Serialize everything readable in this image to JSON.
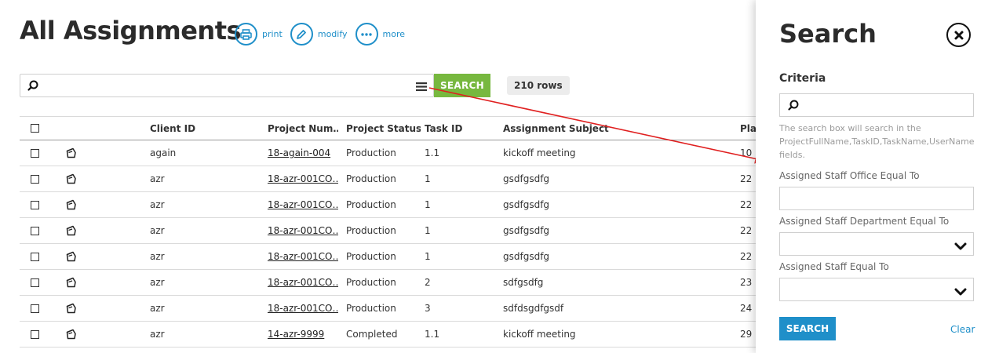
{
  "page": {
    "title": "All Assignments",
    "actions": [
      {
        "label": "print",
        "icon": "printer-icon"
      },
      {
        "label": "modify",
        "icon": "pencil-icon"
      },
      {
        "label": "more",
        "icon": "more-dots-icon"
      }
    ]
  },
  "search": {
    "value": "",
    "button_label": "SEARCH",
    "rows_count": "210 rows"
  },
  "table": {
    "columns": [
      "",
      "",
      "Client ID",
      "Project Num…",
      "Project Status",
      "Task ID",
      "Assignment Subject",
      "Plar"
    ],
    "rows": [
      {
        "client": "again",
        "project": "18-again-004",
        "status": "Production",
        "task": "1.1",
        "subject": "kickoff meeting",
        "plan": "10"
      },
      {
        "client": "azr",
        "project": "18-azr-001CO…",
        "status": "Production",
        "task": "1",
        "subject": "gsdfgsdfg",
        "plan": "22"
      },
      {
        "client": "azr",
        "project": "18-azr-001CO…",
        "status": "Production",
        "task": "1",
        "subject": "gsdfgsdfg",
        "plan": "22"
      },
      {
        "client": "azr",
        "project": "18-azr-001CO…",
        "status": "Production",
        "task": "1",
        "subject": "gsdfgsdfg",
        "plan": "22"
      },
      {
        "client": "azr",
        "project": "18-azr-001CO…",
        "status": "Production",
        "task": "1",
        "subject": "gsdfgsdfg",
        "plan": "22"
      },
      {
        "client": "azr",
        "project": "18-azr-001CO…",
        "status": "Production",
        "task": "2",
        "subject": "sdfgsdfg",
        "plan": "23"
      },
      {
        "client": "azr",
        "project": "18-azr-001CO…",
        "status": "Production",
        "task": "3",
        "subject": "sdfdsgdfgsdf",
        "plan": "24"
      },
      {
        "client": "azr",
        "project": "14-azr-9999",
        "status": "Completed",
        "task": "1.1",
        "subject": "kickoff meeting",
        "plan": "29"
      }
    ]
  },
  "panel": {
    "title": "Search",
    "criteria_label": "Criteria",
    "search_value": "",
    "help_text": "The search box will search in the ProjectFullName,TaskID,TaskName,UserName fields.",
    "fields": [
      {
        "label": "Assigned Staff Office Equal To",
        "value": ""
      },
      {
        "label": "Assigned Staff Department Equal To",
        "value": ""
      },
      {
        "label": "Assigned Staff Equal To",
        "value": ""
      }
    ],
    "search_button": "SEARCH",
    "clear_label": "Clear"
  },
  "colors": {
    "accent_blue": "#1f8fc9",
    "search_green": "#77b83f",
    "arrow_red": "#e02020"
  }
}
